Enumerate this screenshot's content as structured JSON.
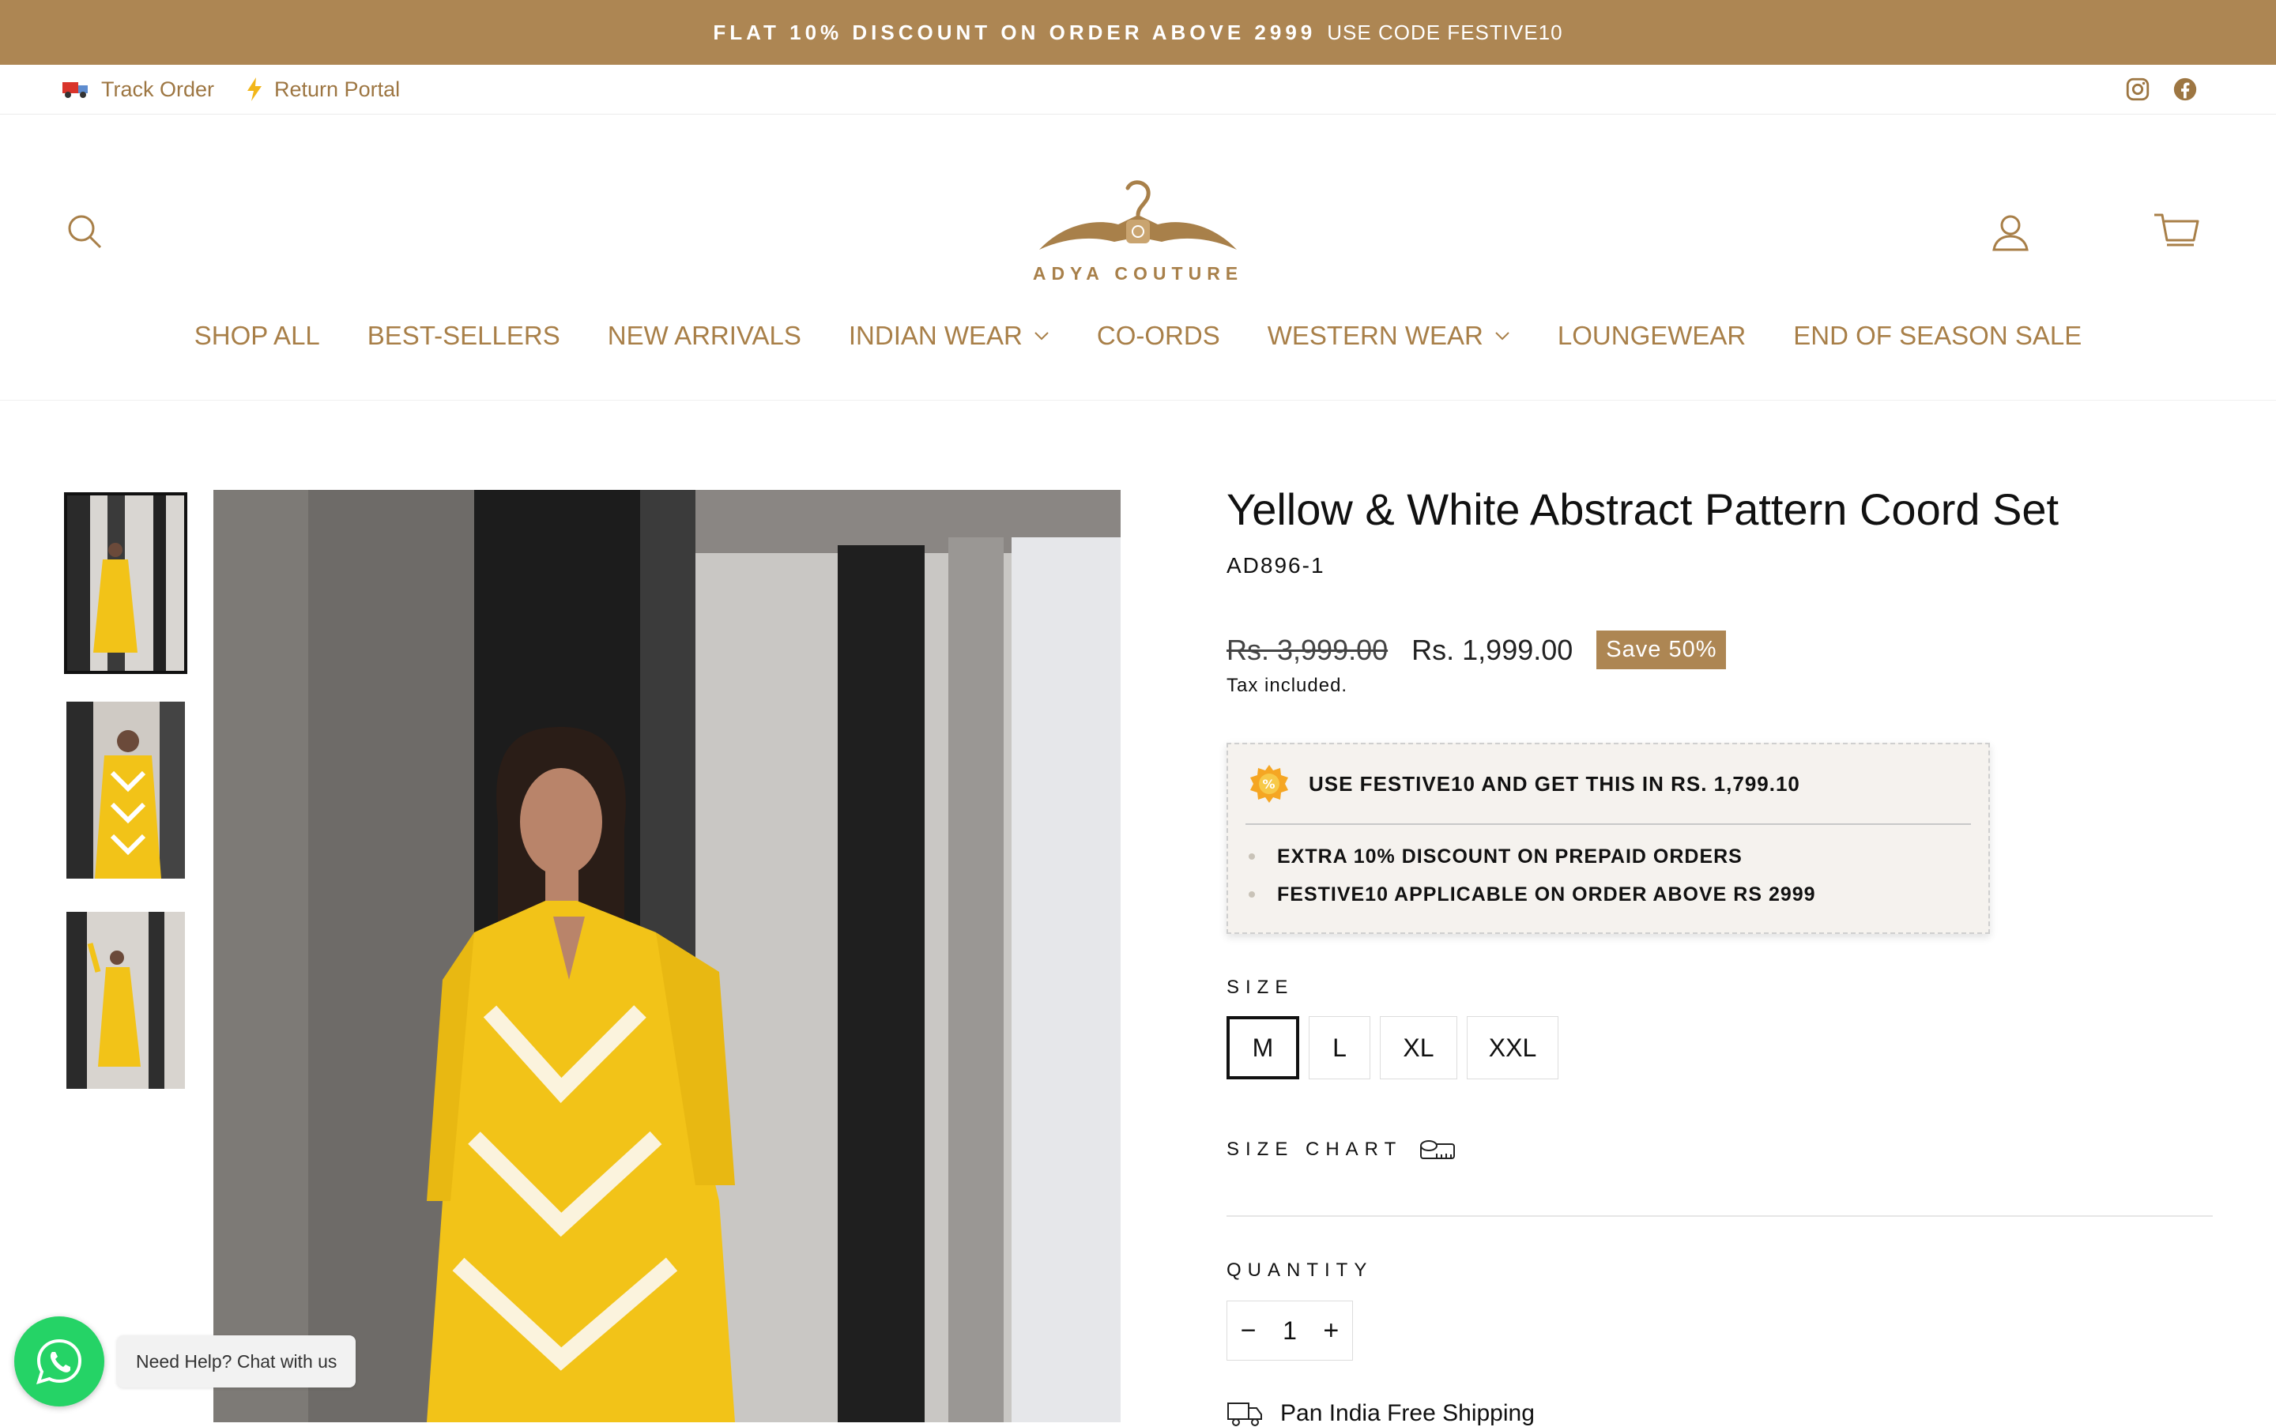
{
  "announcement": {
    "text": "FLAT 10% DISCOUNT ON ORDER ABOVE 2999",
    "code": "USE CODE FESTIVE10"
  },
  "utility": {
    "links": [
      {
        "label": "Track Order",
        "icon": "truck-icon"
      },
      {
        "label": "Return Portal",
        "icon": "lightning-icon"
      }
    ],
    "social": [
      "instagram-icon",
      "facebook-icon"
    ]
  },
  "header": {
    "logo_text": "ADYA COUTURE",
    "icons": [
      "search-icon",
      "account-icon",
      "cart-icon"
    ]
  },
  "nav": [
    {
      "label": "SHOP ALL",
      "dropdown": false
    },
    {
      "label": "BEST-SELLERS",
      "dropdown": false
    },
    {
      "label": "NEW ARRIVALS",
      "dropdown": false
    },
    {
      "label": "INDIAN WEAR",
      "dropdown": true
    },
    {
      "label": "CO-ORDS",
      "dropdown": false
    },
    {
      "label": "WESTERN WEAR",
      "dropdown": true
    },
    {
      "label": "LOUNGEWEAR",
      "dropdown": false
    },
    {
      "label": "END OF SEASON SALE",
      "dropdown": false
    }
  ],
  "product": {
    "title": "Yellow & White Abstract Pattern Coord Set",
    "sku": "AD896-1",
    "compare_price": "Rs. 3,999.00",
    "price": "Rs. 1,999.00",
    "save_badge": "Save 50%",
    "tax_note": "Tax included.",
    "offer": {
      "headline": "USE FESTIVE10 AND GET THIS IN RS. 1,799.10",
      "bullets": [
        "EXTRA 10% DISCOUNT ON PREPAID ORDERS",
        "FESTIVE10 APPLICABLE ON ORDER ABOVE RS 2999"
      ]
    },
    "size_label": "SIZE",
    "sizes": [
      "M",
      "L",
      "XL",
      "XXL"
    ],
    "selected_size": "M",
    "size_chart_label": "SIZE CHART",
    "quantity_label": "QUANTITY",
    "quantity": "1",
    "qty_minus": "−",
    "qty_plus": "+",
    "shipping_note": "Pan India Free Shipping"
  },
  "whatsapp": {
    "text": "Need Help? Chat with us"
  },
  "colors": {
    "brand": "#ad8653",
    "nav_text": "#a87f48",
    "offer_bg": "#f5f2ee",
    "whatsapp": "#25d366"
  }
}
